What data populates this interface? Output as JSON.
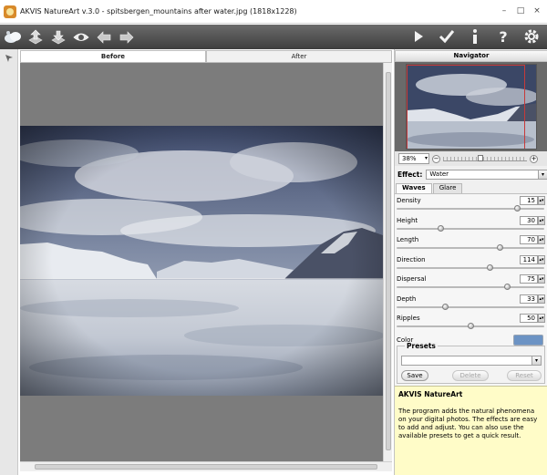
{
  "window": {
    "title": "AKVIS NatureArt v.3.0 - spitsbergen_mountains after water.jpg (1818x1228)",
    "controls": [
      "–",
      "□",
      "×"
    ]
  },
  "toolbar": {
    "left_icons": [
      "clouds-icon",
      "open-file-icon",
      "save-file-icon",
      "preview-eye-icon",
      "undo-arrow-icon",
      "redo-arrow-icon"
    ],
    "right_icons": [
      "run-play-icon",
      "apply-check-icon",
      "info-icon",
      "help-icon",
      "settings-gear-icon"
    ]
  },
  "view_tabs": {
    "before": "Before",
    "after": "After"
  },
  "navigator": {
    "title": "Navigator",
    "zoom": "38%",
    "zoom_level": 0.45
  },
  "effect": {
    "label": "Effect:",
    "value": "Water"
  },
  "sub_tabs": {
    "waves": "Waves",
    "glare": "Glare"
  },
  "params": [
    {
      "label": "Density",
      "value": "15",
      "level": 0.82
    },
    {
      "label": "Height",
      "value": "30",
      "level": 0.3
    },
    {
      "label": "Length",
      "value": "70",
      "level": 0.7
    },
    {
      "label": "Direction",
      "value": "114",
      "level": 0.63
    },
    {
      "label": "Dispersal",
      "value": "75",
      "level": 0.75
    },
    {
      "label": "Depth",
      "value": "33",
      "level": 0.33
    },
    {
      "label": "Ripples",
      "value": "50",
      "level": 0.5
    }
  ],
  "color": {
    "label": "Color",
    "value": "#6c93c4"
  },
  "presets": {
    "title": "Presets",
    "save": "Save",
    "delete": "Delete",
    "reset": "Reset"
  },
  "help": {
    "title": "AKVIS NatureArt",
    "text": "The program adds the natural phenomena on your digital photos. The effects are easy to add and adjust. You can also use the available presets to get a quick result."
  }
}
